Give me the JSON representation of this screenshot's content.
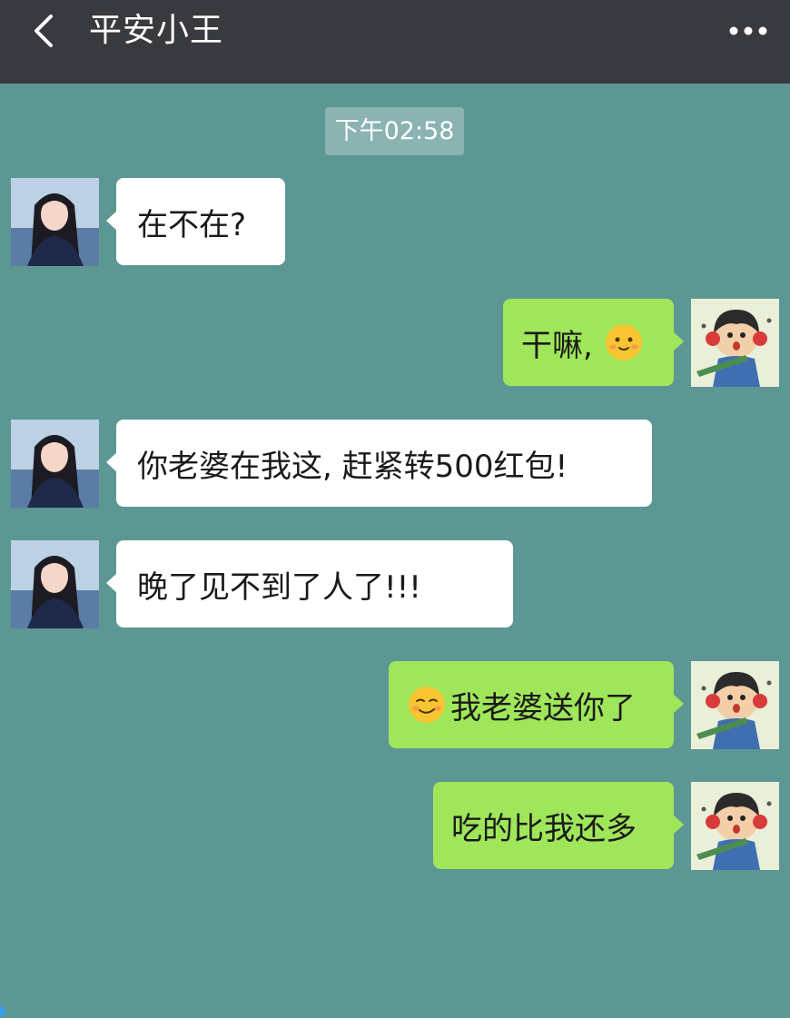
{
  "header": {
    "title": "平安小王",
    "back_icon": "chevron-left-icon",
    "more_icon": "more-dots-icon",
    "background": "#393a3f"
  },
  "chat": {
    "background": "#5d9794",
    "timestamp": "下午02:58",
    "incoming_bubble_color": "#ffffff",
    "outgoing_bubble_color": "#9fe65a",
    "messages": [
      {
        "side": "incoming",
        "text": "在不在?"
      },
      {
        "side": "outgoing",
        "text": "干嘛,",
        "emoji_after": "shy-smile-emoji"
      },
      {
        "side": "incoming",
        "text": "你老婆在我这, 赶紧转500红包!"
      },
      {
        "side": "incoming",
        "text": "晚了见不到了人了!!!"
      },
      {
        "side": "outgoing",
        "emoji_before": "smirk-emoji",
        "text": "我老婆送你了"
      },
      {
        "side": "outgoing",
        "text": "吃的比我还多"
      }
    ]
  }
}
